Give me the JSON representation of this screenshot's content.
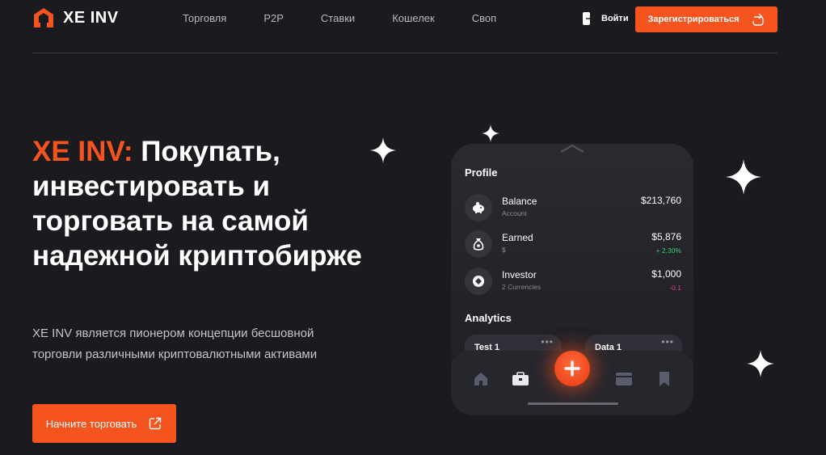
{
  "brand": {
    "name": "XE INV",
    "accent": "#f5541e",
    "logo_icon": "logo-icon"
  },
  "nav": {
    "items": [
      "Торговля",
      "P2P",
      "Ставки",
      "Кошелек",
      "Своп"
    ]
  },
  "auth": {
    "login_label": "Войти",
    "login_icon": "login-icon",
    "register_label": "Зарегистрироваться",
    "register_icon": "refresh-icon"
  },
  "hero": {
    "title_brand": "XE INV:",
    "title_rest": " Покупать, инвестировать и торговать на самой надежной криптобирже",
    "description": "XE INV является пионером концепции бесшовной торговли различными криптовалютными активами",
    "cta_label": "Начните торговать",
    "cta_icon": "external-link-icon"
  },
  "phone": {
    "profile_title": "Profile",
    "rows": [
      {
        "name": "Balance",
        "sub": "Account",
        "value": "$213,760",
        "delta": "",
        "icon": "piggy-bank-icon"
      },
      {
        "name": "Earned",
        "sub": "$",
        "value": "$5,876",
        "delta": "+ 2.30%",
        "delta_color": "#3ccf7a",
        "icon": "money-bag-icon"
      },
      {
        "name": "Investor",
        "sub": "2 Currencies",
        "value": "$1,000",
        "delta": "-0.1",
        "delta_color": "#e0398a",
        "icon": "diamond-icon"
      }
    ],
    "analytics_title": "Analytics",
    "cards": [
      {
        "label": "Test 1"
      },
      {
        "label": "Data 1"
      }
    ],
    "tabs": [
      "home-icon",
      "briefcase-icon",
      "plus-icon",
      "card-icon",
      "bookmark-icon"
    ]
  }
}
